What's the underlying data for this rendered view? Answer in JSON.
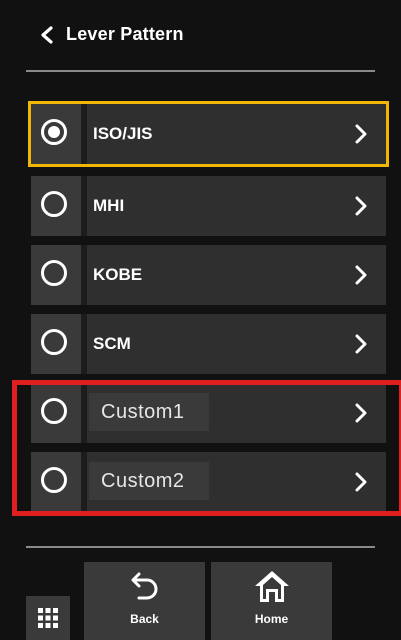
{
  "header": {
    "title": "Lever Pattern"
  },
  "options": [
    {
      "label": "ISO/JIS",
      "selected": true
    },
    {
      "label": "MHI",
      "selected": false
    },
    {
      "label": "KOBE",
      "selected": false
    },
    {
      "label": "SCM",
      "selected": false
    },
    {
      "label": "Custom1",
      "selected": false
    },
    {
      "label": "Custom2",
      "selected": false
    }
  ],
  "footer": {
    "back_label": "Back",
    "home_label": "Home"
  },
  "colors": {
    "selected_outline": "#f2b705",
    "highlight_box": "#e02020",
    "background": "#111111",
    "row": "#2f2f2f"
  },
  "icons": [
    "chevron-left-icon",
    "radio-icon",
    "chevron-right-icon",
    "back-arrow-icon",
    "home-icon",
    "grid-icon"
  ]
}
